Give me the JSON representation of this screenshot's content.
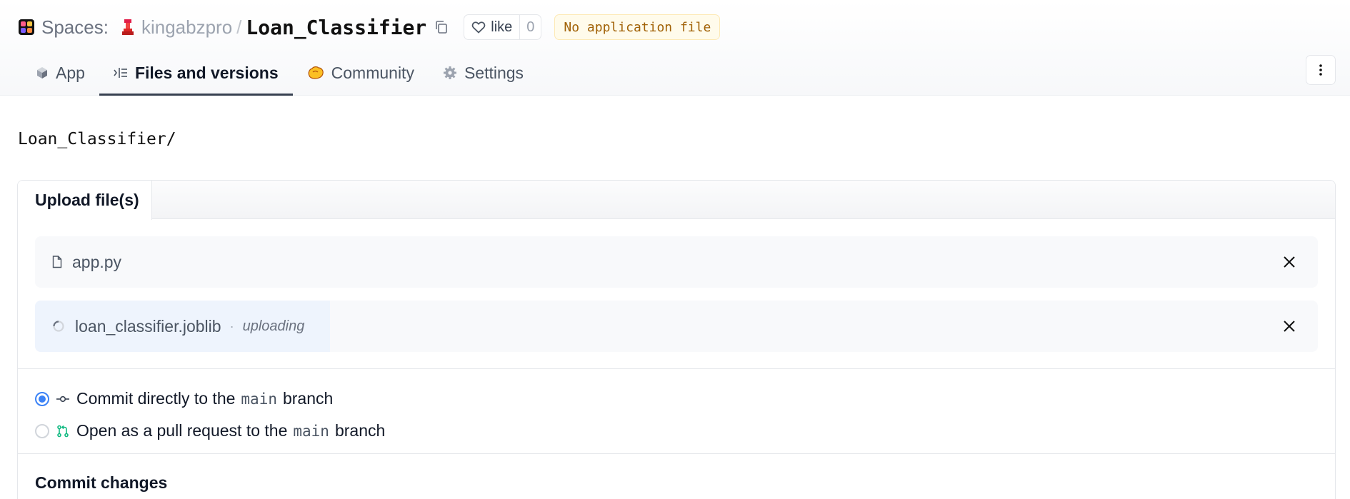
{
  "header": {
    "spaces_label": "Spaces:",
    "owner": "kingabzpro",
    "separator": "/",
    "repo_name": "Loan_Classifier",
    "like_label": "like",
    "like_count": "0",
    "status_badge": "No application file"
  },
  "tabs": [
    {
      "label": "App",
      "icon": "cube-icon",
      "active": false
    },
    {
      "label": "Files and versions",
      "icon": "files-icon",
      "active": true
    },
    {
      "label": "Community",
      "icon": "community-icon",
      "active": false
    },
    {
      "label": "Settings",
      "icon": "gear-icon",
      "active": false
    }
  ],
  "breadcrumb": "Loan_Classifier/",
  "upload": {
    "tab_label": "Upload file(s)",
    "files": [
      {
        "name": "app.py",
        "status": ""
      },
      {
        "name": "loan_classifier.joblib",
        "status": "uploading",
        "progress": 0.23
      }
    ]
  },
  "commit_options": {
    "direct": {
      "prefix": "Commit directly to the",
      "branch": "main",
      "suffix": "branch",
      "checked": true
    },
    "pull_request": {
      "prefix": "Open as a pull request to the",
      "branch": "main",
      "suffix": "branch",
      "checked": false
    }
  },
  "commit_heading": "Commit changes",
  "colors": {
    "accent": "#3b82f6",
    "badge_bg": "#fffbeb",
    "badge_text": "#a16207",
    "pr_icon": "#10b981"
  }
}
